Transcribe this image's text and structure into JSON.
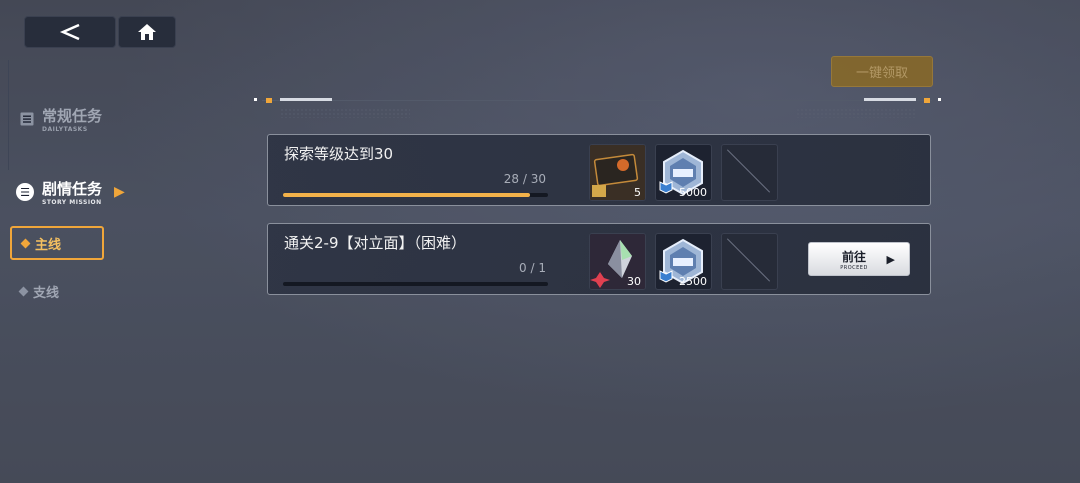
{
  "header": {
    "back_icon": "back-arrow-icon",
    "home_icon": "home-icon",
    "claim_all_label": "一键领取"
  },
  "sidebar": {
    "daily": {
      "label": "常规任务",
      "sublabel": "DAILYTASKS",
      "icon": "list-icon"
    },
    "story": {
      "label": "剧情任务",
      "sublabel": "STORY MISSION",
      "icon": "list-circle-icon"
    },
    "subs": [
      {
        "label": "主线",
        "active": true
      },
      {
        "label": "支线",
        "active": false
      }
    ]
  },
  "colors": {
    "accent": "#f0a63a",
    "progress": "#f3b24a"
  },
  "tasks": [
    {
      "title": "探索等级达到30",
      "progress_text": "28 / 30",
      "progress": 0.933,
      "rewards": [
        {
          "icon": "ticket-card-icon",
          "qty": "5"
        },
        {
          "icon": "crystal-currency-icon",
          "qty": "5000"
        },
        {
          "icon": "empty-slot-icon",
          "qty": ""
        }
      ]
    },
    {
      "title": "通关2-9【对立面】（困难）",
      "progress_text": "0 / 1",
      "progress": 0,
      "rewards": [
        {
          "icon": "prism-shard-icon",
          "qty": "30"
        },
        {
          "icon": "crystal-currency-icon",
          "qty": "2500"
        },
        {
          "icon": "empty-slot-icon",
          "qty": ""
        }
      ],
      "button": {
        "label": "前往",
        "sublabel": "PROCEED"
      }
    }
  ]
}
